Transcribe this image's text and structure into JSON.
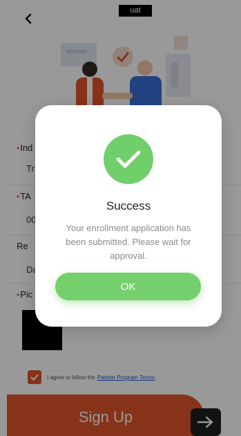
{
  "header": {
    "env_badge": "uat"
  },
  "form": {
    "fields": [
      {
        "label": "Ind",
        "value": "Tr",
        "required": true
      },
      {
        "label": "TA",
        "value": "00",
        "required": true
      },
      {
        "label": "Re",
        "value": "Da",
        "required": false
      },
      {
        "label": "Pic",
        "value": "",
        "required": true
      }
    ],
    "agree": {
      "text": "I agree to follow the",
      "link": "Partner Program Terms",
      "suffix": "."
    },
    "submit_label": "Sign Up"
  },
  "modal": {
    "title": "Success",
    "message": "Your enrollment application has been submitted. Please wait for approval.",
    "ok_label": "OK"
  },
  "colors": {
    "accent_orange": "#e0552b",
    "success_green": "#6fcf6a",
    "link_blue": "#1a56c9"
  },
  "icons": [
    "back-arrow-icon",
    "checkmark-icon",
    "arrow-right-icon"
  ]
}
